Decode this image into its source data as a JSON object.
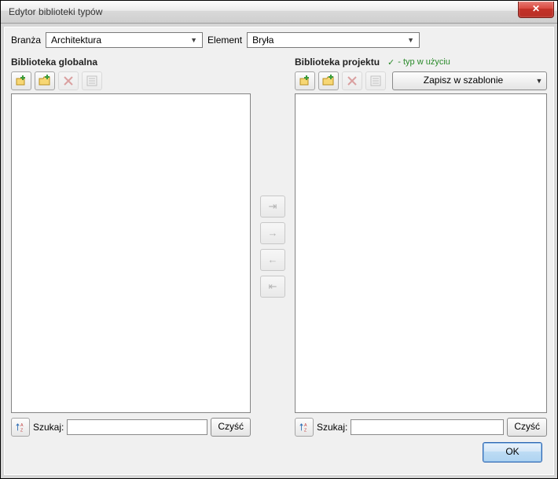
{
  "window": {
    "title": "Edytor biblioteki typów"
  },
  "row": {
    "branza_label": "Branża",
    "branza_value": "Architektura",
    "element_label": "Element",
    "element_value": "Bryła"
  },
  "left": {
    "header": "Biblioteka globalna",
    "search_label": "Szukaj:",
    "clear_label": "Czyść"
  },
  "right": {
    "header": "Biblioteka projektu",
    "in_use": "- typ w użyciu",
    "save_label": "Zapisz w szablonie",
    "search_label": "Szukaj:",
    "clear_label": "Czyść"
  },
  "footer": {
    "ok": "OK"
  }
}
